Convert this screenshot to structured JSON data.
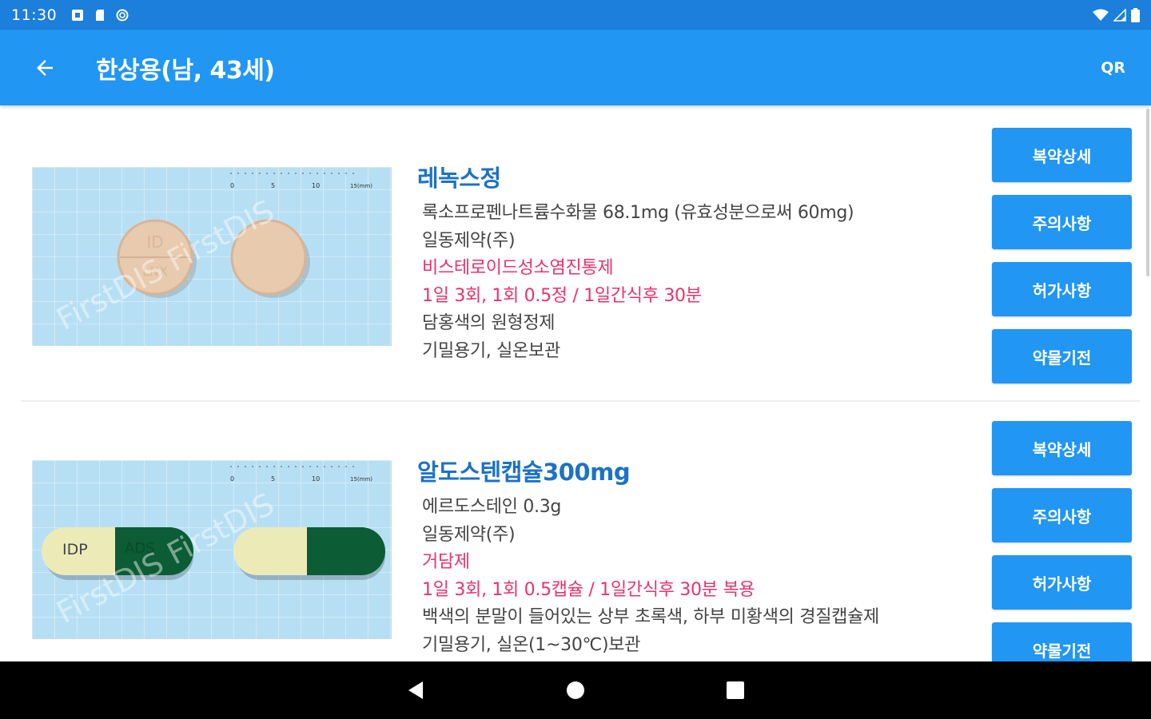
{
  "status_bar": {
    "time": "11:30",
    "left_icons": [
      "notification-icon",
      "sd-card-icon",
      "sync-icon"
    ],
    "right_icons": [
      "wifi-icon",
      "signal-icon",
      "battery-icon"
    ]
  },
  "app_bar": {
    "title": "한상용(남, 43세)",
    "back_icon": "arrow-back-icon",
    "qr_label": "QR",
    "color": "#2196f3"
  },
  "drugs": [
    {
      "name": "레녹스정",
      "ingredient": "록소프로펜나트륨수화물 68.1mg (유효성분으로써 60mg)",
      "manufacturer": "일동제약(주)",
      "category": "비스테로이드성소염진통제",
      "dosage": "1일 3회, 1회 0.5정 / 1일간식후 30분",
      "appearance": "담홍색의 원형정제",
      "storage": "기밀용기, 실온보관",
      "photo": {
        "watermark": "FirstDIS FirstDIS",
        "pill_marks": [
          "ID",
          "LNX"
        ],
        "scale_ticks": [
          "0",
          "5",
          "10",
          "15(mm)"
        ]
      },
      "buttons": [
        "복약상세",
        "주의사항",
        "허가사항",
        "약물기전"
      ]
    },
    {
      "name": "알도스텐캡슐300mg",
      "ingredient": "에르도스테인 0.3g",
      "manufacturer": "일동제약(주)",
      "category": "거담제",
      "dosage": "1일 3회, 1회 0.5캡슐 / 1일간식후 30분 복용",
      "appearance": "백색의 분말이 들어있는 상부 초록색, 하부 미황색의 경질캡슐제",
      "storage": "기밀용기, 실온(1~30℃)보관",
      "photo": {
        "watermark": "FirstDIS FirstDIS",
        "pill_marks": [
          "IDP",
          "ADS"
        ],
        "scale_ticks": [
          "0",
          "5",
          "10",
          "15(mm)"
        ]
      },
      "buttons": [
        "복약상세",
        "주의사항",
        "허가사항",
        "약물기전"
      ]
    }
  ],
  "colors": {
    "status_bar": "#1c7fdb",
    "accent": "#2196f3",
    "drug_name": "#1c72c6",
    "highlight": "#e8336b"
  },
  "nav_bar": {
    "icons": [
      "nav-back-icon",
      "nav-home-icon",
      "nav-recents-icon"
    ]
  }
}
